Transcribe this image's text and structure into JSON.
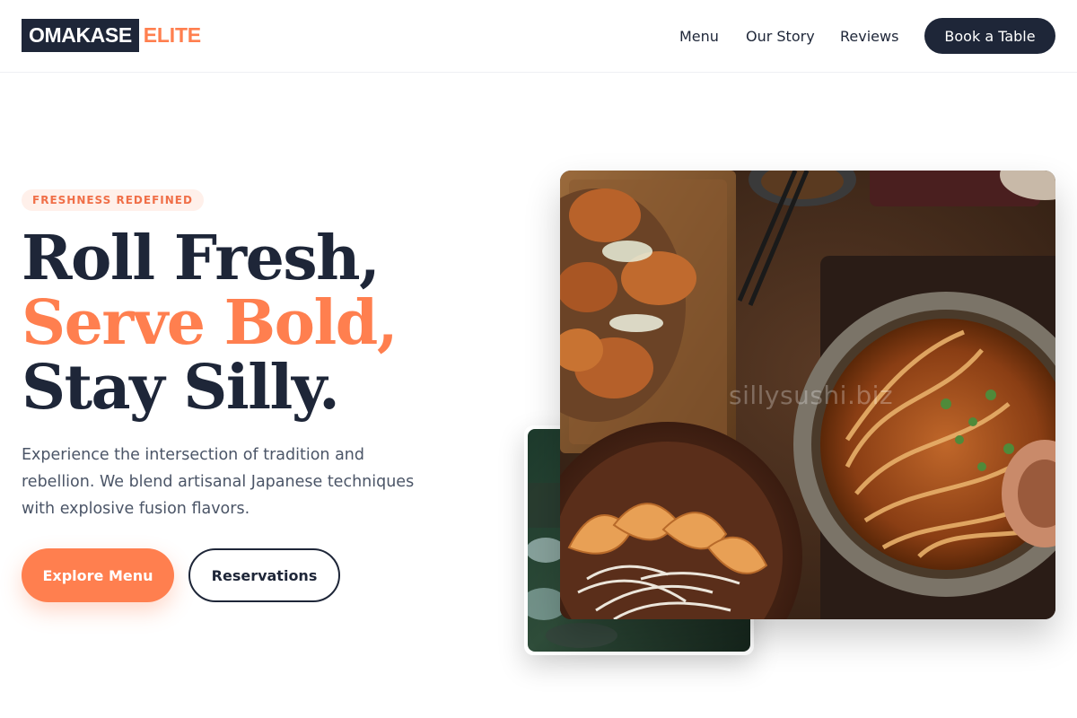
{
  "header": {
    "logo_main": "OMAKASE",
    "logo_accent": "ELITE",
    "nav": [
      "Menu",
      "Our Story",
      "Reviews"
    ],
    "cta": "Book a Table"
  },
  "hero": {
    "badge": "FRESHNESS REDEFINED",
    "headline": [
      "Roll Fresh,",
      "Serve Bold,",
      "Stay Silly."
    ],
    "lead": "Experience the intersection of tradition and rebellion. We blend artisanal Japanese techniques with explosive fusion flavors.",
    "primary_button": "Explore Menu",
    "secondary_button": "Reservations",
    "watermark": "sillysushi.biz"
  },
  "colors": {
    "navy": "#1e2638",
    "accent": "#ff7f4f",
    "badge_bg": "#fff0ea",
    "body_text": "#4b5567"
  },
  "images": {
    "main": "food-spread-photo (karaage, ramen bowl, gyoza, chopsticks)",
    "secondary": "restaurant-table-photo"
  }
}
